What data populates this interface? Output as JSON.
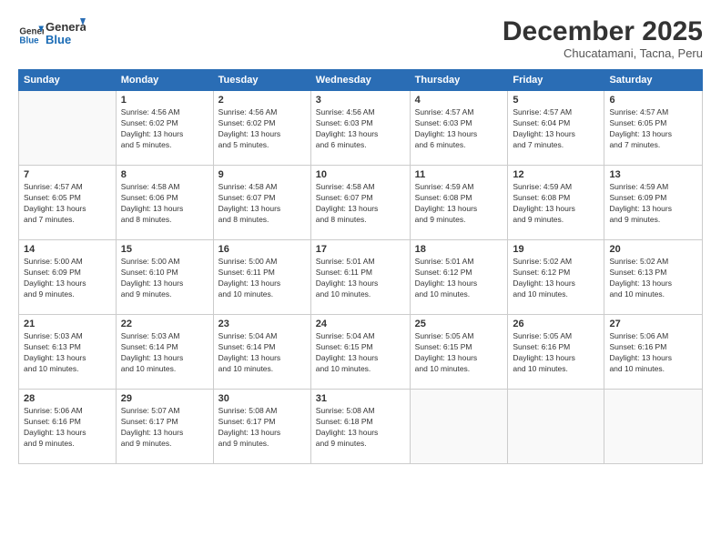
{
  "logo": {
    "line1": "General",
    "line2": "Blue"
  },
  "calendar": {
    "title": "December 2025",
    "subtitle": "Chucatamani, Tacna, Peru"
  },
  "header_days": [
    "Sunday",
    "Monday",
    "Tuesday",
    "Wednesday",
    "Thursday",
    "Friday",
    "Saturday"
  ],
  "weeks": [
    [
      {
        "date": "",
        "info": ""
      },
      {
        "date": "1",
        "info": "Sunrise: 4:56 AM\nSunset: 6:02 PM\nDaylight: 13 hours\nand 5 minutes."
      },
      {
        "date": "2",
        "info": "Sunrise: 4:56 AM\nSunset: 6:02 PM\nDaylight: 13 hours\nand 5 minutes."
      },
      {
        "date": "3",
        "info": "Sunrise: 4:56 AM\nSunset: 6:03 PM\nDaylight: 13 hours\nand 6 minutes."
      },
      {
        "date": "4",
        "info": "Sunrise: 4:57 AM\nSunset: 6:03 PM\nDaylight: 13 hours\nand 6 minutes."
      },
      {
        "date": "5",
        "info": "Sunrise: 4:57 AM\nSunset: 6:04 PM\nDaylight: 13 hours\nand 7 minutes."
      },
      {
        "date": "6",
        "info": "Sunrise: 4:57 AM\nSunset: 6:05 PM\nDaylight: 13 hours\nand 7 minutes."
      }
    ],
    [
      {
        "date": "7",
        "info": "Sunrise: 4:57 AM\nSunset: 6:05 PM\nDaylight: 13 hours\nand 7 minutes."
      },
      {
        "date": "8",
        "info": "Sunrise: 4:58 AM\nSunset: 6:06 PM\nDaylight: 13 hours\nand 8 minutes."
      },
      {
        "date": "9",
        "info": "Sunrise: 4:58 AM\nSunset: 6:07 PM\nDaylight: 13 hours\nand 8 minutes."
      },
      {
        "date": "10",
        "info": "Sunrise: 4:58 AM\nSunset: 6:07 PM\nDaylight: 13 hours\nand 8 minutes."
      },
      {
        "date": "11",
        "info": "Sunrise: 4:59 AM\nSunset: 6:08 PM\nDaylight: 13 hours\nand 9 minutes."
      },
      {
        "date": "12",
        "info": "Sunrise: 4:59 AM\nSunset: 6:08 PM\nDaylight: 13 hours\nand 9 minutes."
      },
      {
        "date": "13",
        "info": "Sunrise: 4:59 AM\nSunset: 6:09 PM\nDaylight: 13 hours\nand 9 minutes."
      }
    ],
    [
      {
        "date": "14",
        "info": "Sunrise: 5:00 AM\nSunset: 6:09 PM\nDaylight: 13 hours\nand 9 minutes."
      },
      {
        "date": "15",
        "info": "Sunrise: 5:00 AM\nSunset: 6:10 PM\nDaylight: 13 hours\nand 9 minutes."
      },
      {
        "date": "16",
        "info": "Sunrise: 5:00 AM\nSunset: 6:11 PM\nDaylight: 13 hours\nand 10 minutes."
      },
      {
        "date": "17",
        "info": "Sunrise: 5:01 AM\nSunset: 6:11 PM\nDaylight: 13 hours\nand 10 minutes."
      },
      {
        "date": "18",
        "info": "Sunrise: 5:01 AM\nSunset: 6:12 PM\nDaylight: 13 hours\nand 10 minutes."
      },
      {
        "date": "19",
        "info": "Sunrise: 5:02 AM\nSunset: 6:12 PM\nDaylight: 13 hours\nand 10 minutes."
      },
      {
        "date": "20",
        "info": "Sunrise: 5:02 AM\nSunset: 6:13 PM\nDaylight: 13 hours\nand 10 minutes."
      }
    ],
    [
      {
        "date": "21",
        "info": "Sunrise: 5:03 AM\nSunset: 6:13 PM\nDaylight: 13 hours\nand 10 minutes."
      },
      {
        "date": "22",
        "info": "Sunrise: 5:03 AM\nSunset: 6:14 PM\nDaylight: 13 hours\nand 10 minutes."
      },
      {
        "date": "23",
        "info": "Sunrise: 5:04 AM\nSunset: 6:14 PM\nDaylight: 13 hours\nand 10 minutes."
      },
      {
        "date": "24",
        "info": "Sunrise: 5:04 AM\nSunset: 6:15 PM\nDaylight: 13 hours\nand 10 minutes."
      },
      {
        "date": "25",
        "info": "Sunrise: 5:05 AM\nSunset: 6:15 PM\nDaylight: 13 hours\nand 10 minutes."
      },
      {
        "date": "26",
        "info": "Sunrise: 5:05 AM\nSunset: 6:16 PM\nDaylight: 13 hours\nand 10 minutes."
      },
      {
        "date": "27",
        "info": "Sunrise: 5:06 AM\nSunset: 6:16 PM\nDaylight: 13 hours\nand 10 minutes."
      }
    ],
    [
      {
        "date": "28",
        "info": "Sunrise: 5:06 AM\nSunset: 6:16 PM\nDaylight: 13 hours\nand 9 minutes."
      },
      {
        "date": "29",
        "info": "Sunrise: 5:07 AM\nSunset: 6:17 PM\nDaylight: 13 hours\nand 9 minutes."
      },
      {
        "date": "30",
        "info": "Sunrise: 5:08 AM\nSunset: 6:17 PM\nDaylight: 13 hours\nand 9 minutes."
      },
      {
        "date": "31",
        "info": "Sunrise: 5:08 AM\nSunset: 6:18 PM\nDaylight: 13 hours\nand 9 minutes."
      },
      {
        "date": "",
        "info": ""
      },
      {
        "date": "",
        "info": ""
      },
      {
        "date": "",
        "info": ""
      }
    ]
  ]
}
